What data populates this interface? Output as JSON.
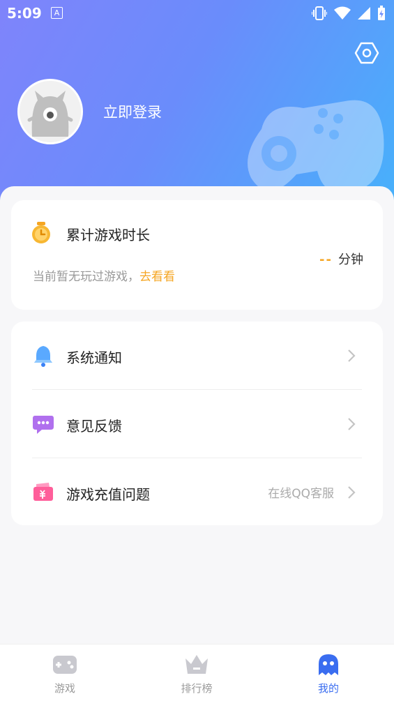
{
  "status": {
    "time": "5:09",
    "notif_glyph": "A"
  },
  "header": {
    "login_text": "立即登录"
  },
  "play_time": {
    "title": "累计游戏时长",
    "subtitle": "当前暂无玩过游戏，",
    "link": "去看看",
    "value": "--",
    "unit": "分钟"
  },
  "menu": [
    {
      "label": "系统通知",
      "extra": "",
      "icon": "bell-icon"
    },
    {
      "label": "意见反馈",
      "extra": "",
      "icon": "chat-bubble-icon"
    },
    {
      "label": "游戏充值问题",
      "extra": "在线QQ客服",
      "icon": "wallet-icon"
    }
  ],
  "tabs": [
    {
      "label": "游戏",
      "icon": "gamepad-icon",
      "active": false
    },
    {
      "label": "排行榜",
      "icon": "crown-icon",
      "active": false
    },
    {
      "label": "我的",
      "icon": "ghost-icon",
      "active": true
    }
  ],
  "colors": {
    "accent": "#3a6df0",
    "link": "#f5a623",
    "header_start": "#7f84fb",
    "header_end": "#47b1fb"
  }
}
